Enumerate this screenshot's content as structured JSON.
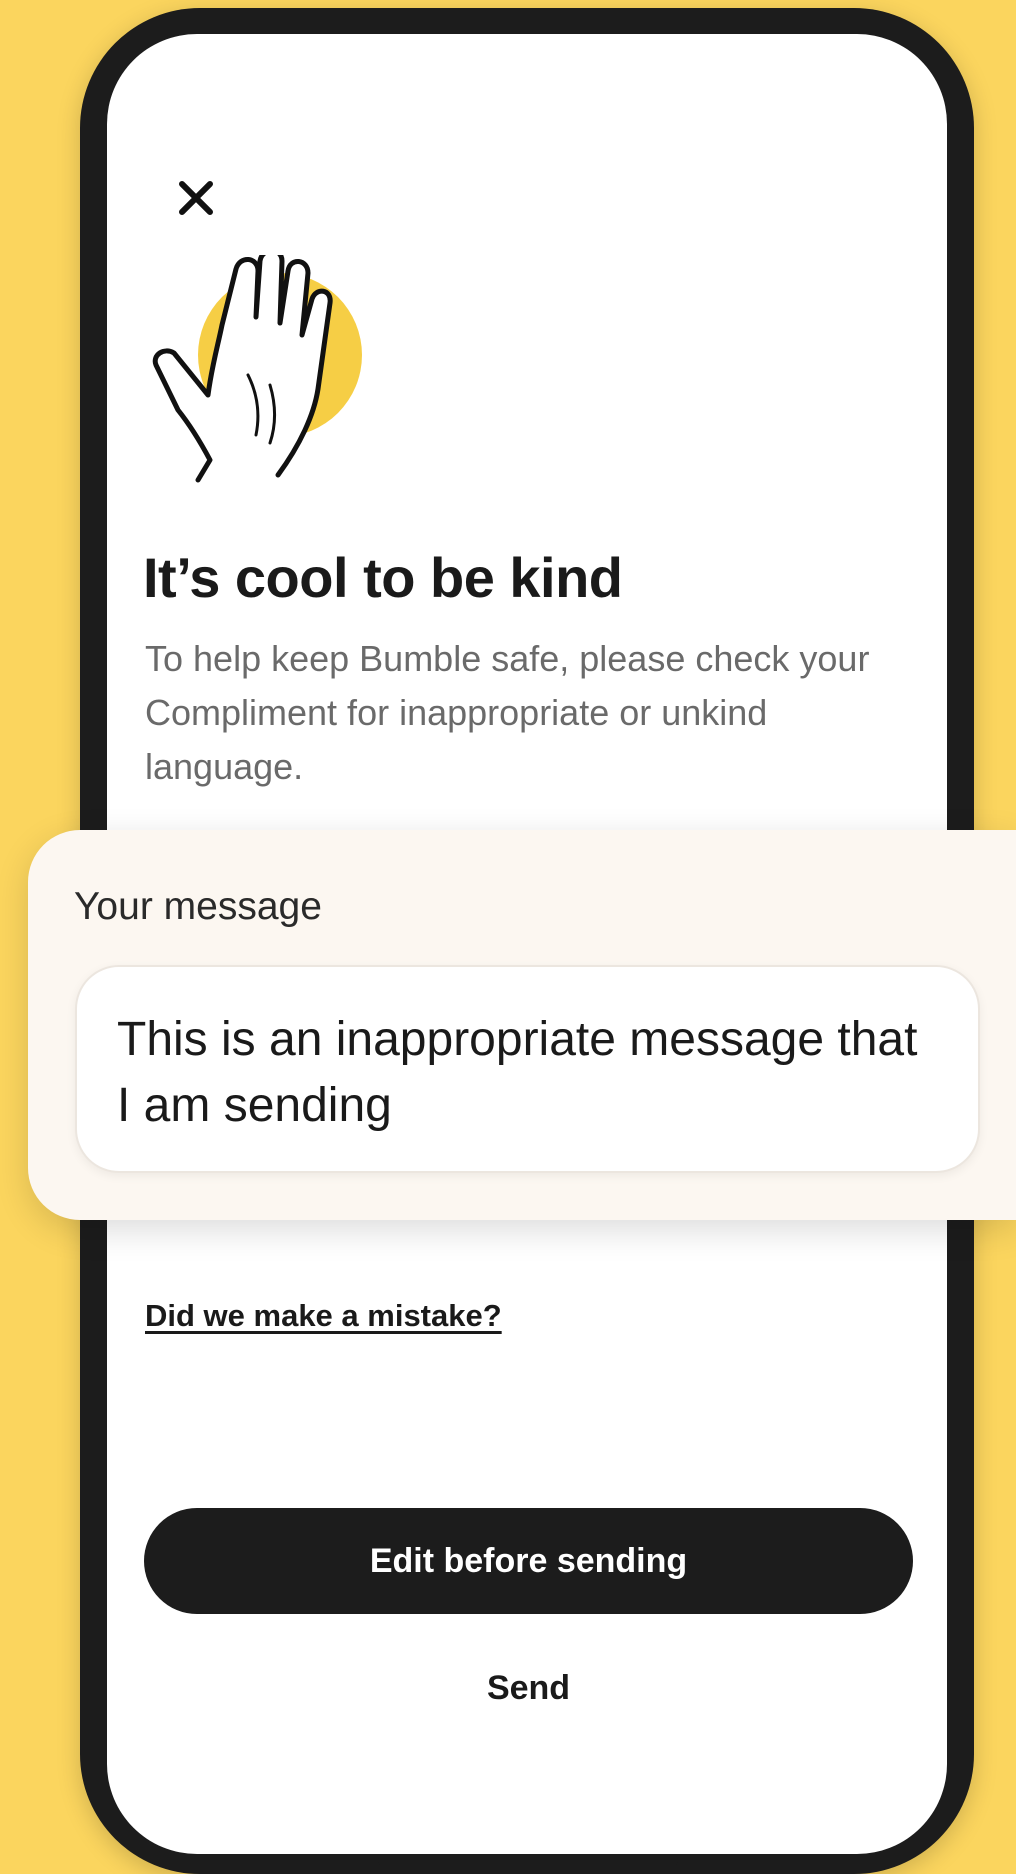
{
  "colors": {
    "background": "#FBD55E",
    "accent_yellow": "#F6CE45",
    "button_dark": "#1c1c1c",
    "panel_bg": "#FCF7F1"
  },
  "icons": {
    "close": "close-icon",
    "illustration": "raised-hand-icon"
  },
  "modal": {
    "title": "It’s cool to be kind",
    "description": "To help keep Bumble safe, please check your Compliment for inappropriate or unkind language."
  },
  "message_panel": {
    "label": "Your message",
    "text": "This is an inappropriate message that I am sending"
  },
  "links": {
    "mistake": "Did we make a mistake?"
  },
  "actions": {
    "edit_label": "Edit before sending",
    "send_label": "Send"
  }
}
